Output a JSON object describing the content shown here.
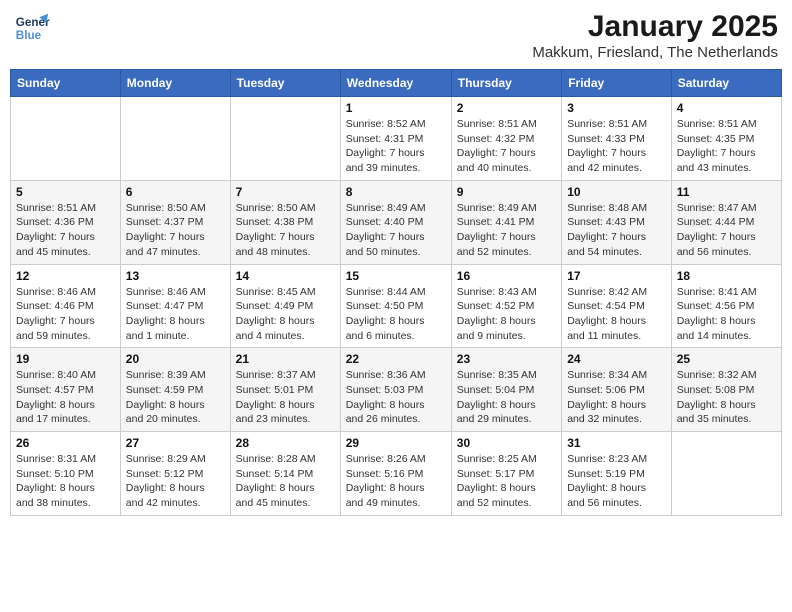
{
  "logo": {
    "line1": "General",
    "line2": "Blue"
  },
  "title": "January 2025",
  "subtitle": "Makkum, Friesland, The Netherlands",
  "days_of_week": [
    "Sunday",
    "Monday",
    "Tuesday",
    "Wednesday",
    "Thursday",
    "Friday",
    "Saturday"
  ],
  "weeks": [
    [
      {
        "day": "",
        "info": ""
      },
      {
        "day": "",
        "info": ""
      },
      {
        "day": "",
        "info": ""
      },
      {
        "day": "1",
        "info": "Sunrise: 8:52 AM\nSunset: 4:31 PM\nDaylight: 7 hours\nand 39 minutes."
      },
      {
        "day": "2",
        "info": "Sunrise: 8:51 AM\nSunset: 4:32 PM\nDaylight: 7 hours\nand 40 minutes."
      },
      {
        "day": "3",
        "info": "Sunrise: 8:51 AM\nSunset: 4:33 PM\nDaylight: 7 hours\nand 42 minutes."
      },
      {
        "day": "4",
        "info": "Sunrise: 8:51 AM\nSunset: 4:35 PM\nDaylight: 7 hours\nand 43 minutes."
      }
    ],
    [
      {
        "day": "5",
        "info": "Sunrise: 8:51 AM\nSunset: 4:36 PM\nDaylight: 7 hours\nand 45 minutes."
      },
      {
        "day": "6",
        "info": "Sunrise: 8:50 AM\nSunset: 4:37 PM\nDaylight: 7 hours\nand 47 minutes."
      },
      {
        "day": "7",
        "info": "Sunrise: 8:50 AM\nSunset: 4:38 PM\nDaylight: 7 hours\nand 48 minutes."
      },
      {
        "day": "8",
        "info": "Sunrise: 8:49 AM\nSunset: 4:40 PM\nDaylight: 7 hours\nand 50 minutes."
      },
      {
        "day": "9",
        "info": "Sunrise: 8:49 AM\nSunset: 4:41 PM\nDaylight: 7 hours\nand 52 minutes."
      },
      {
        "day": "10",
        "info": "Sunrise: 8:48 AM\nSunset: 4:43 PM\nDaylight: 7 hours\nand 54 minutes."
      },
      {
        "day": "11",
        "info": "Sunrise: 8:47 AM\nSunset: 4:44 PM\nDaylight: 7 hours\nand 56 minutes."
      }
    ],
    [
      {
        "day": "12",
        "info": "Sunrise: 8:46 AM\nSunset: 4:46 PM\nDaylight: 7 hours\nand 59 minutes."
      },
      {
        "day": "13",
        "info": "Sunrise: 8:46 AM\nSunset: 4:47 PM\nDaylight: 8 hours\nand 1 minute."
      },
      {
        "day": "14",
        "info": "Sunrise: 8:45 AM\nSunset: 4:49 PM\nDaylight: 8 hours\nand 4 minutes."
      },
      {
        "day": "15",
        "info": "Sunrise: 8:44 AM\nSunset: 4:50 PM\nDaylight: 8 hours\nand 6 minutes."
      },
      {
        "day": "16",
        "info": "Sunrise: 8:43 AM\nSunset: 4:52 PM\nDaylight: 8 hours\nand 9 minutes."
      },
      {
        "day": "17",
        "info": "Sunrise: 8:42 AM\nSunset: 4:54 PM\nDaylight: 8 hours\nand 11 minutes."
      },
      {
        "day": "18",
        "info": "Sunrise: 8:41 AM\nSunset: 4:56 PM\nDaylight: 8 hours\nand 14 minutes."
      }
    ],
    [
      {
        "day": "19",
        "info": "Sunrise: 8:40 AM\nSunset: 4:57 PM\nDaylight: 8 hours\nand 17 minutes."
      },
      {
        "day": "20",
        "info": "Sunrise: 8:39 AM\nSunset: 4:59 PM\nDaylight: 8 hours\nand 20 minutes."
      },
      {
        "day": "21",
        "info": "Sunrise: 8:37 AM\nSunset: 5:01 PM\nDaylight: 8 hours\nand 23 minutes."
      },
      {
        "day": "22",
        "info": "Sunrise: 8:36 AM\nSunset: 5:03 PM\nDaylight: 8 hours\nand 26 minutes."
      },
      {
        "day": "23",
        "info": "Sunrise: 8:35 AM\nSunset: 5:04 PM\nDaylight: 8 hours\nand 29 minutes."
      },
      {
        "day": "24",
        "info": "Sunrise: 8:34 AM\nSunset: 5:06 PM\nDaylight: 8 hours\nand 32 minutes."
      },
      {
        "day": "25",
        "info": "Sunrise: 8:32 AM\nSunset: 5:08 PM\nDaylight: 8 hours\nand 35 minutes."
      }
    ],
    [
      {
        "day": "26",
        "info": "Sunrise: 8:31 AM\nSunset: 5:10 PM\nDaylight: 8 hours\nand 38 minutes."
      },
      {
        "day": "27",
        "info": "Sunrise: 8:29 AM\nSunset: 5:12 PM\nDaylight: 8 hours\nand 42 minutes."
      },
      {
        "day": "28",
        "info": "Sunrise: 8:28 AM\nSunset: 5:14 PM\nDaylight: 8 hours\nand 45 minutes."
      },
      {
        "day": "29",
        "info": "Sunrise: 8:26 AM\nSunset: 5:16 PM\nDaylight: 8 hours\nand 49 minutes."
      },
      {
        "day": "30",
        "info": "Sunrise: 8:25 AM\nSunset: 5:17 PM\nDaylight: 8 hours\nand 52 minutes."
      },
      {
        "day": "31",
        "info": "Sunrise: 8:23 AM\nSunset: 5:19 PM\nDaylight: 8 hours\nand 56 minutes."
      },
      {
        "day": "",
        "info": ""
      }
    ]
  ]
}
